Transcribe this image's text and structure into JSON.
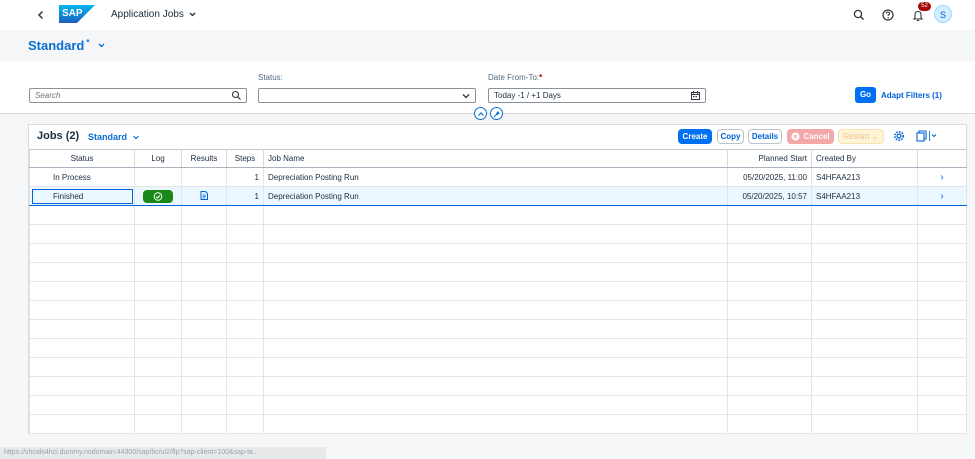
{
  "shell": {
    "app_title": "Application Jobs",
    "logo_text": "SAP",
    "notification_count": "52",
    "avatar_initial": "S"
  },
  "variant": {
    "title": "Standard",
    "modified_marker": "*"
  },
  "filters": {
    "search_placeholder": "Search",
    "status_label": "Status:",
    "status_value": "",
    "date_label": "Date From-To:",
    "date_required_marker": "*",
    "date_value": "Today -1 / +1 Days",
    "go_label": "Go",
    "adapt_label": "Adapt Filters (1)"
  },
  "table": {
    "title": "Jobs (2)",
    "variant": "Standard",
    "buttons": {
      "create": "Create",
      "copy": "Copy",
      "details": "Details",
      "cancel": "Cancel",
      "restart": "Restart"
    },
    "columns": [
      "Status",
      "Log",
      "Results",
      "Steps",
      "Job Name",
      "Planned Start",
      "Created By"
    ],
    "rows": [
      {
        "status": "In Process",
        "log": "",
        "results": "",
        "steps": "1",
        "job_name": "Depreciation Posting Run",
        "planned_start": "05/20/2025, 11:00",
        "created_by": "S4HFAA213"
      },
      {
        "status": "Finished",
        "log": "success",
        "results": "document",
        "steps": "1",
        "job_name": "Depreciation Posting Run",
        "planned_start": "05/20/2025, 10:57",
        "created_by": "S4HFAA213"
      }
    ]
  },
  "status_bar_url": "https://vhcals4hci.dummy.nodomain:44300/sap/bc/ui2/flp?sap-client=100&sap-la...",
  "colors": {
    "accent": "#0070f2",
    "brand_title": "#0a6ed1",
    "success": "#188918",
    "badge": "#aa0808"
  }
}
